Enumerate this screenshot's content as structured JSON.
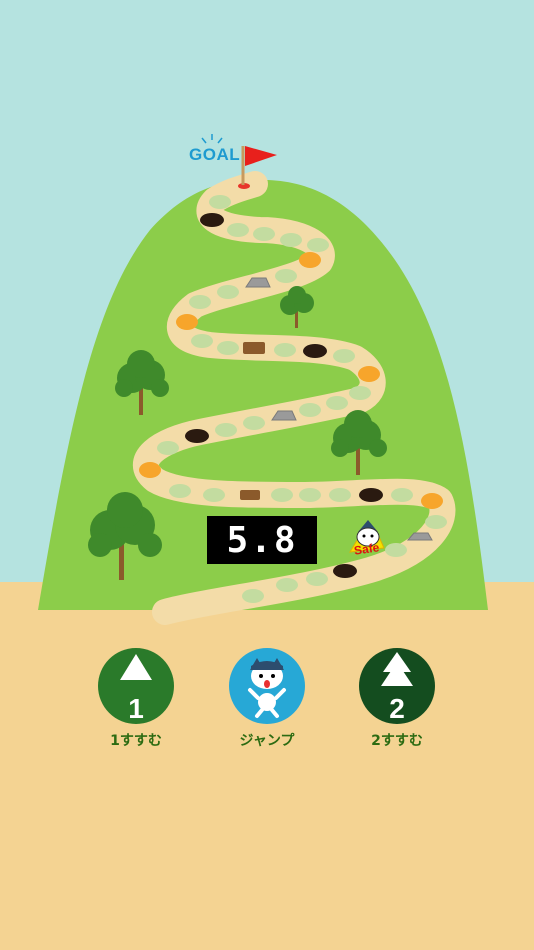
{
  "goal": {
    "label": "GOAL"
  },
  "timer": {
    "value": "5.8"
  },
  "status": {
    "safe": "Safe"
  },
  "controls": {
    "step1": {
      "number": "1",
      "label": "1すすむ"
    },
    "jump": {
      "label": "ジャンプ"
    },
    "step2": {
      "number": "2",
      "label": "2すすむ"
    }
  },
  "colors": {
    "sky": "#b5e3e0",
    "ground": "#f4d392",
    "hill": "#8ccd4a",
    "path": "#f3dca8",
    "accent_orange": "#f7a52b",
    "button_green": "#2a7a2a",
    "button_dark": "#144d1f",
    "button_blue": "#27a8d6"
  },
  "icons": [
    "flag-icon",
    "tree-icon",
    "rock-icon",
    "stump-icon",
    "hole-icon",
    "cat-character-icon",
    "arrow-up-icon",
    "double-arrow-up-icon"
  ]
}
